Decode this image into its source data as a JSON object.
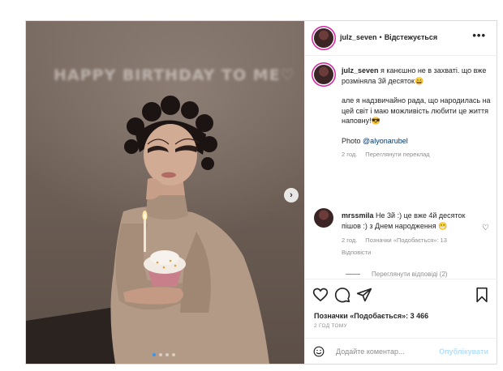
{
  "post": {
    "image": {
      "neon_text": "HAPPY BIRTHDAY TO ME♡",
      "carousel": {
        "count": 4,
        "active_index": 0
      },
      "next_icon": "chevron-right-icon"
    },
    "header": {
      "username": "julz_seven",
      "separator": "•",
      "follow_status": "Відстежується",
      "more_icon": "more-icon"
    },
    "caption": {
      "username": "julz_seven",
      "line1": "я канєшно не в захваті. що вже розміняла 3й десяток😄",
      "line2": "але я надзвичайно рада, що народилась на цей світ і маю можливість любити це життя наповну!😎",
      "photo_label": "Photo",
      "photo_credit": "@alyonarubel",
      "time": "2 год.",
      "translate": "Переглянути переклад"
    },
    "comment": {
      "username": "mrssmila",
      "text": "Не 3й :) це вже 4й десяток пішов :) з Днем народження 😁",
      "time": "2 год.",
      "likes": "Позначки «Подобається»: 13",
      "reply": "Відповісти",
      "view_replies": "Переглянути відповіді (2)"
    },
    "actions": {
      "likes_text": "Позначки «Подобається»: 3 466",
      "time_ago": "2 ГОД ТОМУ"
    },
    "composer": {
      "placeholder": "Додайте коментар...",
      "publish": "Опублікувати"
    },
    "colors": {
      "link": "#00376b",
      "accent": "#3897f0",
      "publish": "#b2dffc",
      "ring": "#d6249f"
    }
  }
}
